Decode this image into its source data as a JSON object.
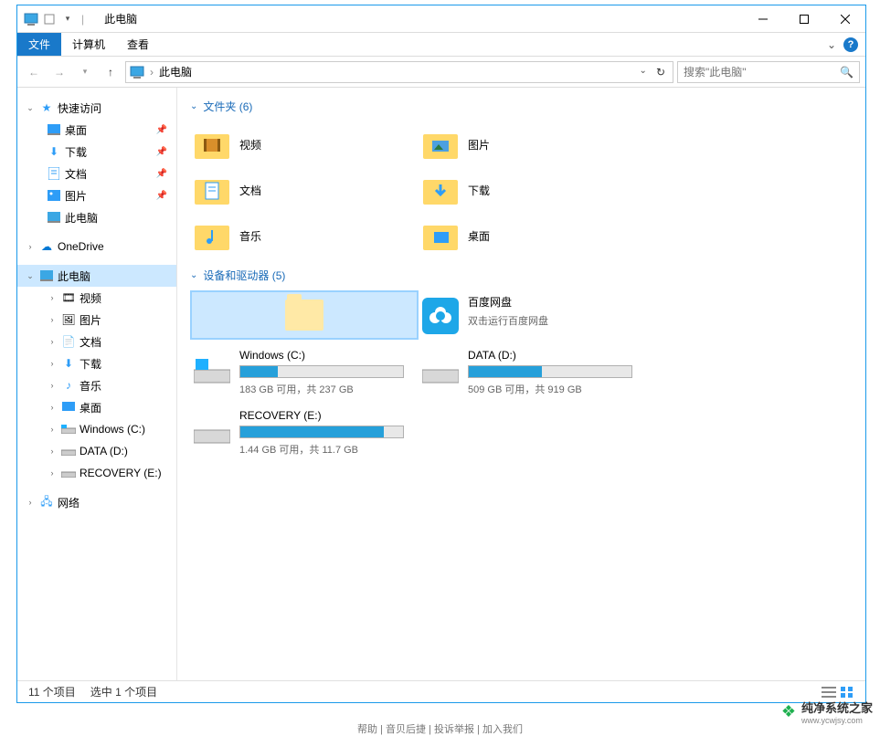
{
  "titlebar": {
    "title": "此电脑",
    "sep": "|"
  },
  "ribbon": {
    "file": "文件",
    "computer": "计算机",
    "view": "查看",
    "expand_caret": "⌄"
  },
  "nav": {
    "breadcrumb": "此电脑",
    "sep": "›",
    "refresh": "↻",
    "dropdown": "⌄"
  },
  "search": {
    "placeholder": "搜索\"此电脑\""
  },
  "sidebar": {
    "quick": "快速访问",
    "quick_items": [
      {
        "label": "桌面"
      },
      {
        "label": "下载"
      },
      {
        "label": "文档"
      },
      {
        "label": "图片"
      },
      {
        "label": "此电脑"
      }
    ],
    "onedrive": "OneDrive",
    "thispc": "此电脑",
    "pc_items": [
      {
        "label": "视频"
      },
      {
        "label": "图片"
      },
      {
        "label": "文档"
      },
      {
        "label": "下载"
      },
      {
        "label": "音乐"
      },
      {
        "label": "桌面"
      },
      {
        "label": "Windows (C:)"
      },
      {
        "label": "DATA (D:)"
      },
      {
        "label": "RECOVERY (E:)"
      }
    ],
    "network": "网络"
  },
  "content": {
    "folders_header": "文件夹 (6)",
    "folders": [
      {
        "label": "视频"
      },
      {
        "label": "图片"
      },
      {
        "label": "文档"
      },
      {
        "label": "下载"
      },
      {
        "label": "音乐"
      },
      {
        "label": "桌面"
      }
    ],
    "drives_header": "设备和驱动器 (5)",
    "baidu": {
      "name": "百度网盘",
      "sub": "双击运行百度网盘"
    },
    "drives": [
      {
        "name": "Windows (C:)",
        "info": "183 GB 可用，共 237 GB",
        "pct": 23
      },
      {
        "name": "DATA (D:)",
        "info": "509 GB 可用，共 919 GB",
        "pct": 45
      },
      {
        "name": "RECOVERY (E:)",
        "info": "1.44 GB 可用，共 11.7 GB",
        "pct": 88
      }
    ]
  },
  "status": {
    "count": "11 个项目",
    "selected": "选中 1 个项目"
  },
  "watermark": {
    "name": "纯净系统之家",
    "url": "www.ycwjsy.com"
  },
  "bottom_links": "帮助 | 音贝后捷 | 投诉举报 | 加入我们"
}
